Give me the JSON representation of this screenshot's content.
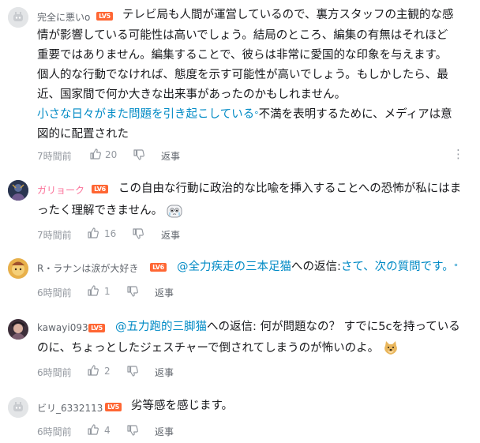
{
  "comments": [
    {
      "username": "完全に悪いo",
      "level": "LV5",
      "lines": [
        "テレビ局も人間が運営しているので、裏方スタッフの主観的な感",
        "情が影響している可能性は高いでしょう。結局のところ、編集の有無はそれほど",
        "重要ではありません。編集することで、彼らは非常に愛国的な印象を与えます。",
        "個人的な行動でなければ、態度を示す可能性が高いでしょう。もしかしたら、最",
        "近、国家間で何か大きな出来事があったのかもしれません。"
      ],
      "link_text": "小さな日々がまた問題を引き起こしている",
      "after_link_1": "不満を表明するために、メディアは意",
      "after_link_2": "図的に配置された",
      "time": "7時間前",
      "likes": "20",
      "reply": "返事",
      "more": "⋮"
    },
    {
      "username": "ガリョーク",
      "level": "LV6",
      "line1": "この自由な行動に政治的な比喩を挿入することへの恐怖が私にはま",
      "line2": "ったく理解できません。",
      "time": "7時間前",
      "likes": "16",
      "reply": "返事"
    },
    {
      "username": "R・ラナンは涙が大好き",
      "level": "LV6",
      "mention": "@全力疾走の三本足猫",
      "reply_prefix": "への返信:",
      "link_text": "さて、次の質問です。",
      "time": "6時間前",
      "likes": "1",
      "reply": "返事"
    },
    {
      "username": "kawayi093",
      "level": "LV5",
      "mention": "@五力跑的三脚猫",
      "line1_rest": "への返信: 何が問題なの？ すでに5cを持っている",
      "line2": "のに、ちょっとしたジェスチャーで倒されてしまうのが怖いのよ。",
      "time": "6時間前",
      "likes": "2",
      "reply": "返事"
    },
    {
      "username": "ビリ_6332113",
      "level": "LV5",
      "text": "劣等感を感じます。",
      "time": "6時間前",
      "likes": "4",
      "reply": "返事"
    }
  ]
}
